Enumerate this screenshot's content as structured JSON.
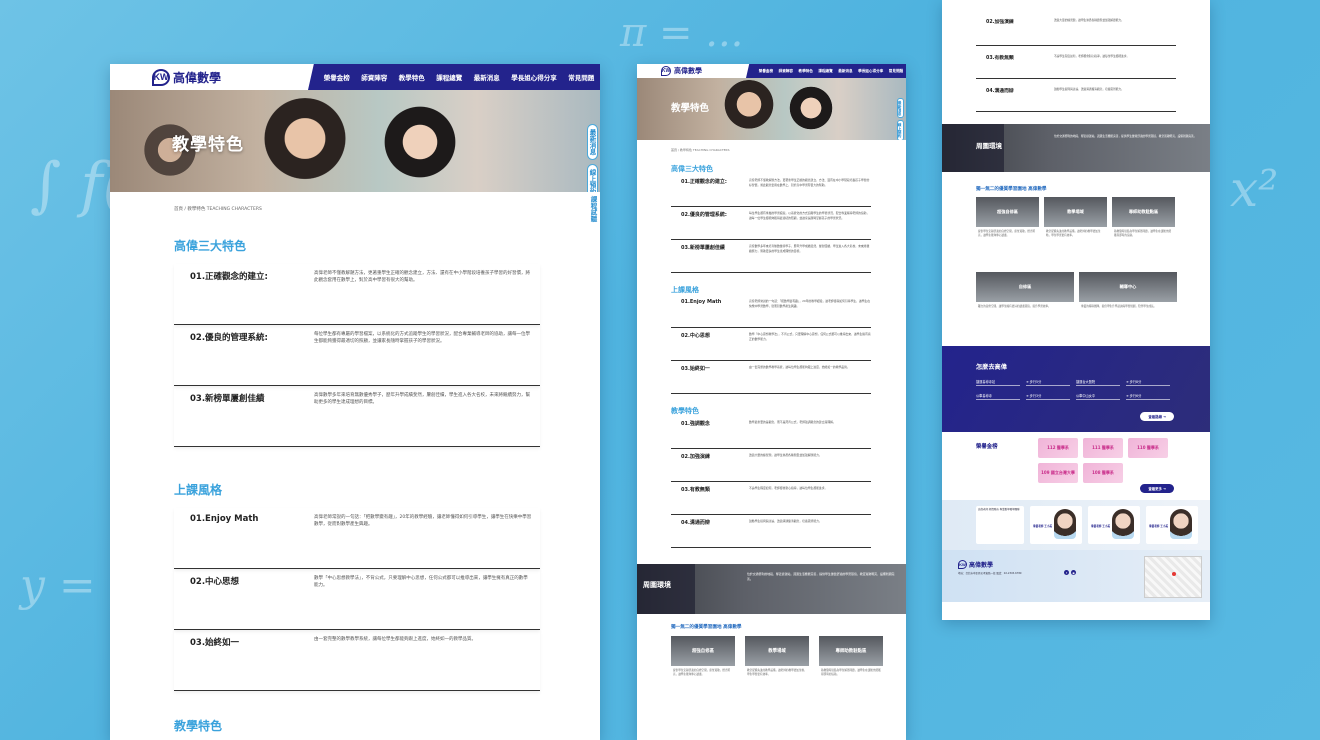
{
  "brand": {
    "logo_mark": "KW",
    "name": "高偉數學"
  },
  "nav": [
    "榮譽金榜",
    "師資陣容",
    "教學特色",
    "課程總覽",
    "最新消息",
    "學長姐心得分享",
    "常見問題"
  ],
  "hero_title": "教學特色",
  "side_tabs": [
    "最新消息",
    "線上預約",
    "課程試聽"
  ],
  "breadcrumb": "首頁 / 教學特色  TEACHING CHARACTERS",
  "sections": [
    {
      "title": "高偉三大特色",
      "items": [
        {
          "head": "01.正確觀念的建立:",
          "body": "高偉老師不僅教解題方法，更著重學生正確的觀念建立，方法、還有在中小學階段培養孩子學習的好習慣，將此觀念套用在數學上，對於高中學習有很大的幫助。"
        },
        {
          "head": "02.優良的管理系統:",
          "body": "每位學生都有專屬的學習檔案，以系統化的方式追蹤學生的學習狀況，配合專業輔導老師的協助，讓每一位學生都能夠獲得最適切的照顧，並讓家長隨時掌握孩子的學習狀況。"
        },
        {
          "head": "03.新榜單屢創佳績",
          "body": "高偉數學多年來培育無數優秀學子，歷年升學成績斐然，屢創佳績，學生進入各大名校，未來將繼續努力，幫助更多的學生達成理想的目標。"
        }
      ]
    },
    {
      "title": "上課風格",
      "items": [
        {
          "head": "01.Enjoy Math",
          "body": "高偉老師常說的一句話：「把數學變有趣」，20年的教學經驗，讓老師懂得如何引導學生，讓學生在快樂中學習數學，從而對數學產生興趣。"
        },
        {
          "head": "02.中心思想",
          "body": "數學「中心思想教學法」，不背公式，只要理解中心思想，任何公式都可以推導出來，讓學生擁有真正的數學能力。"
        },
        {
          "head": "03.始終如一",
          "body": "由一套完整的數學教學系統，讓每位學生都能夠跟上進度，始終如一的教學品質。"
        }
      ]
    },
    {
      "title": "教學特色"
    }
  ],
  "mid_section3_items": [
    {
      "head": "01.強調觀念",
      "body": "數學最重要的是觀念，而不是死背公式，老師強調觀念的建立與理解。"
    },
    {
      "head": "02.加強演練",
      "body": "透過大量的練習題，讓學生熟悉各種題型並加強解題能力。"
    },
    {
      "head": "03.有教無類",
      "body": "不論學生程度如何，老師都會耐心指導，讓每位學生都能進步。"
    },
    {
      "head": "04.溝通而辯",
      "body": "鼓勵學生提問與討論，透過溝通釐清觀念，培養思辨能力。"
    }
  ],
  "environment": {
    "label": "周圍環境",
    "text": "位於交通便利的地段，鄰近捷運站，週邊生活機能完善，提供學生優質舒適的學習環境，教室寬敞明亮，設備新穎完善。",
    "tiles_title": "獨一無二的優質學習園地 高偉數學",
    "tiles": [
      {
        "name": "超強自修區",
        "caption": "提供學生安靜舒適的自修空間，座位寬敞，燈光明亮，讓學生能夠專心讀書。"
      },
      {
        "name": "教學場域",
        "caption": "教室配備先進的教學設備，讓老師的教學更加生動，學生學習更有效率。"
      },
      {
        "name": "專師助教駐點區",
        "caption": "助教隨時駐點為學生解答問題，讓學生在課後也能獲得即時的協助。"
      },
      {
        "name": "自修區",
        "caption": "獨立的自修空間，讓學生擁有更好的讀書環境，提升學習效率。"
      },
      {
        "name": "輔導中心",
        "caption": "專業的輔導團隊，提供學生升學諮詢與學習規劃，陪伴學生成長。"
      }
    ]
  },
  "how_to_get": {
    "title": "怎麼去高偉",
    "grid": [
      "捷運善導寺站",
      "➔ 步行5分",
      "捷運台大醫院",
      "➔ 步行8分",
      "公車善導寺",
      "➔ 步行3分",
      "公車中山女中",
      "➔ 步行6分"
    ],
    "button": "查看路線 ➜"
  },
  "honor": {
    "title": "榮譽金榜",
    "badges": [
      "112 醫學系",
      "111 醫學系",
      "110 醫學系",
      "109 國立台灣大學",
      "108 醫學系"
    ],
    "button": "查看更多 ➜"
  },
  "teachers": {
    "info": "高偉老師 師資陣容 專業數學教學團隊",
    "cards": [
      "專業老師 王小美",
      "專業老師 王小美",
      "專業老師 王小美"
    ]
  },
  "footer": {
    "address": "地址：台北市中正區忠孝東路一段 電話：02-2345-6789",
    "social": [
      "f",
      "◉"
    ]
  },
  "colors": {
    "primary": "#23238c",
    "accent": "#3aa2dc",
    "background": "#55b7e1"
  }
}
